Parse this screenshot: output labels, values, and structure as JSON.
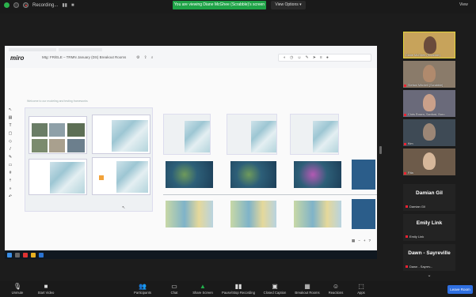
{
  "topbar": {
    "recording_label": "Recording...",
    "viewing_banner": "You are viewing Diane McGhee (Scrabble)'s screen",
    "view_options": "View Options ▾",
    "view_label": "View"
  },
  "miro": {
    "logo": "miro",
    "board_title": "Mtg: FR/ELE – TRMN January (DS) Breakout Rooms",
    "board_caption": "Welcome to our modeling and testing frameworks"
  },
  "participants": [
    {
      "label": "Diane McGhee (Scrabble)",
      "bg": "#c7a35b",
      "face": "#6a4b3b"
    },
    {
      "label": "Stefani Mitchell (Scrabble)",
      "bg": "#8a7b6a",
      "face": "#b08a6d"
    },
    {
      "label": "Chris Rosen, Sanford, Boro",
      "bg": "#6a6a7a",
      "face": "#caa08a"
    },
    {
      "label": "Kim",
      "bg": "#3e4a55",
      "face": "#9b8676"
    },
    {
      "label": "Rita",
      "bg": "#6d5b4a",
      "face": "#d6b79a"
    }
  ],
  "name_tiles": [
    {
      "name": "Damian Gil",
      "sub": "Damian Gil"
    },
    {
      "name": "Emily Link",
      "sub": "Emily Link"
    },
    {
      "name": "Dawn - Sayreville",
      "sub": "Dawn - Sayrev..."
    }
  ],
  "toolbar": {
    "unmute": "Unmute",
    "start_video": "Start Video",
    "participants": "Participants",
    "chat": "Chat",
    "share_screen": "Share Screen",
    "recording": "Pause/Stop Recording",
    "closed_caption": "Closed Caption",
    "breakout_rooms": "Breakout Rooms",
    "reactions": "Reactions",
    "apps": "Apps",
    "leave": "Leave Room"
  },
  "colors": {
    "accent_blue": "#2f6fe0",
    "banner_green": "#1fa347"
  }
}
